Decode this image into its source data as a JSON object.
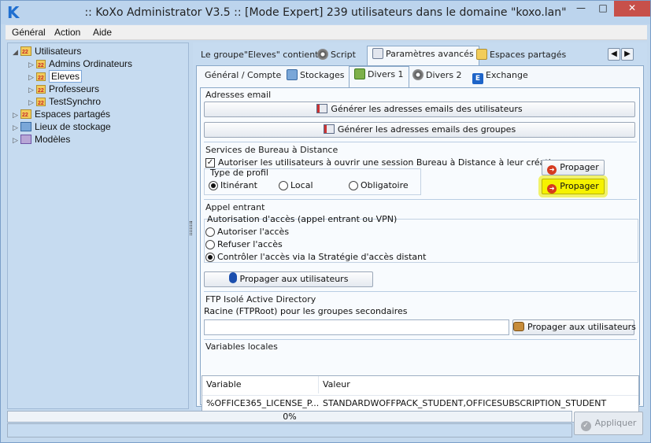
{
  "window": {
    "title": ":: KoXo Administrator V3.5 :: [Mode Expert] 239 utilisateurs dans le domaine \"koxo.lan\"",
    "minimize": "—",
    "maximize": "□",
    "close": "✕"
  },
  "menu": [
    "Général",
    "Action",
    "Aide"
  ],
  "tree": {
    "root": "Utilisateurs",
    "children": [
      "Admins Ordinateurs",
      "Eleves",
      "Professeurs",
      "TestSynchro"
    ],
    "selected": "Eleves",
    "others": [
      "Espaces partagés",
      "Lieux de stockage",
      "Modèles"
    ]
  },
  "tabs_top": [
    "Le groupe\"Eleves\" contient",
    "Script",
    "Paramètres avancés",
    "Espaces partagés"
  ],
  "tabs_top_active": "Paramètres avancés",
  "tabs_sub": [
    "Général / Compte",
    "Stockages",
    "Divers 1",
    "Divers 2",
    "Exchange"
  ],
  "tabs_sub_active": "Divers 1",
  "email": {
    "title": "Adresses email",
    "btn_users": "Générer les adresses emails des utilisateurs",
    "btn_groups": "Générer les adresses emails des groupes"
  },
  "rds": {
    "title": "Services de Bureau à Distance",
    "allow_label": "Autoriser les utilisateurs à ouvrir une session Bureau à Distance à leur création",
    "allow_checked": true,
    "profile_title": "Type de profil",
    "profiles": [
      "Itinérant",
      "Local",
      "Obligatoire"
    ],
    "profile_selected": "Itinérant",
    "propagate1": "Propager",
    "propagate2": "Propager"
  },
  "dialin": {
    "title": "Appel entrant",
    "subtitle": "Autorisation d'accès (appel entrant ou VPN)",
    "options": [
      "Autoriser l'accès",
      "Refuser l'accès",
      "Contrôler l'accès via la Stratégie d'accès distant"
    ],
    "selected": "Contrôler l'accès via la Stratégie d'accès distant",
    "propagate": "Propager aux utilisateurs"
  },
  "ftp": {
    "title": "FTP Isolé Active Directory",
    "root_label": "Racine (FTPRoot) pour les groupes secondaires",
    "root_value": "",
    "propagate": "Propager aux utilisateurs"
  },
  "vars": {
    "title": "Variables locales",
    "columns": [
      "Variable",
      "Valeur"
    ],
    "rows": [
      [
        "%OFFICE365_LICENSE_P...",
        "STANDARDWOFFPACK_STUDENT,OFFICESUBSCRIPTION_STUDENT"
      ]
    ]
  },
  "progress": {
    "text": "0%",
    "value": 0,
    "color": "#36b53b"
  },
  "apply": "Appliquer",
  "colors": {
    "highlight": "#f6f200",
    "close": "#c7504a"
  }
}
